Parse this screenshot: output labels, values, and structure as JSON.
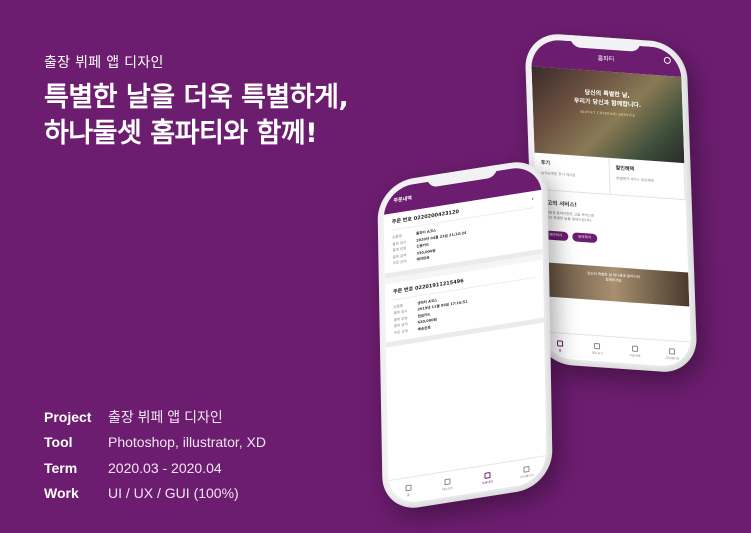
{
  "subtitle": "출장 뷔페 앱 디자인",
  "headline": {
    "line1": "특별한 날을 더욱 특별하게,",
    "line2": "하나둘셋 홈파티와 함께!"
  },
  "info": [
    {
      "key": "Project",
      "value": "출장 뷔페 앱 디자인"
    },
    {
      "key": "Tool",
      "value": "Photoshop, illustrator, XD"
    },
    {
      "key": "Term",
      "value": "2020.03 - 2020.04"
    },
    {
      "key": "Work",
      "value": "UI / UX / GUI (100%)"
    }
  ],
  "colors": {
    "brand": "#6c1d6f",
    "phone_body": "#f2f2f4"
  },
  "back_phone": {
    "logo": "홈파티",
    "hero_line1": "당신의 특별한 날,",
    "hero_line2": "우리가 당신과 함께합니다.",
    "hero_sub": "BUFFET CATERING SERVICE",
    "card1_title": "후기",
    "card1_sub": "솔직담백한 후기 게시판",
    "card2_title": "할인혜택",
    "card2_sub": "편쌤예약 서비스 할인혜택",
    "best_title": "최고의 서비스!",
    "best_desc1": "하나둘셋 홈파티만의 고급 서비스로",
    "best_desc2": "당신의 특별한 날을 빛내드립니다.",
    "btn1": "예약하기",
    "btn2": "문의하기",
    "img2_text1": "당신의 특별한 날 하나둘셋 홈파티와",
    "img2_text2": "함께하세요",
    "tabs": [
      "홈",
      "메뉴보기",
      "주문내역",
      "마이페이지"
    ]
  },
  "front_phone": {
    "title": "주문내역",
    "orders": [
      {
        "number_label": "주문 번호",
        "number": "0220200423120",
        "rows": [
          {
            "k": "상품명",
            "v": "홈파티 A코스"
          },
          {
            "k": "결제 일시",
            "v": "2020년 04월 23일 21:32:24"
          },
          {
            "k": "결제 방법",
            "v": "신용카드"
          },
          {
            "k": "결제 금액",
            "v": "330,000원"
          },
          {
            "k": "주문 상태",
            "v": "예약완료"
          }
        ]
      },
      {
        "number_label": "주문 번호",
        "number": "02201911215496",
        "rows": [
          {
            "k": "상품명",
            "v": "생파티 A코스"
          },
          {
            "k": "결제 일시",
            "v": "2019년 11월 09일 17:16:51"
          },
          {
            "k": "결제 방법",
            "v": "현금카드"
          },
          {
            "k": "결제 금액",
            "v": "620,000원"
          },
          {
            "k": "주문 상태",
            "v": "배송완료"
          }
        ]
      }
    ],
    "tabs": [
      "홈",
      "메뉴보기",
      "주문내역",
      "마이페이지"
    ]
  }
}
